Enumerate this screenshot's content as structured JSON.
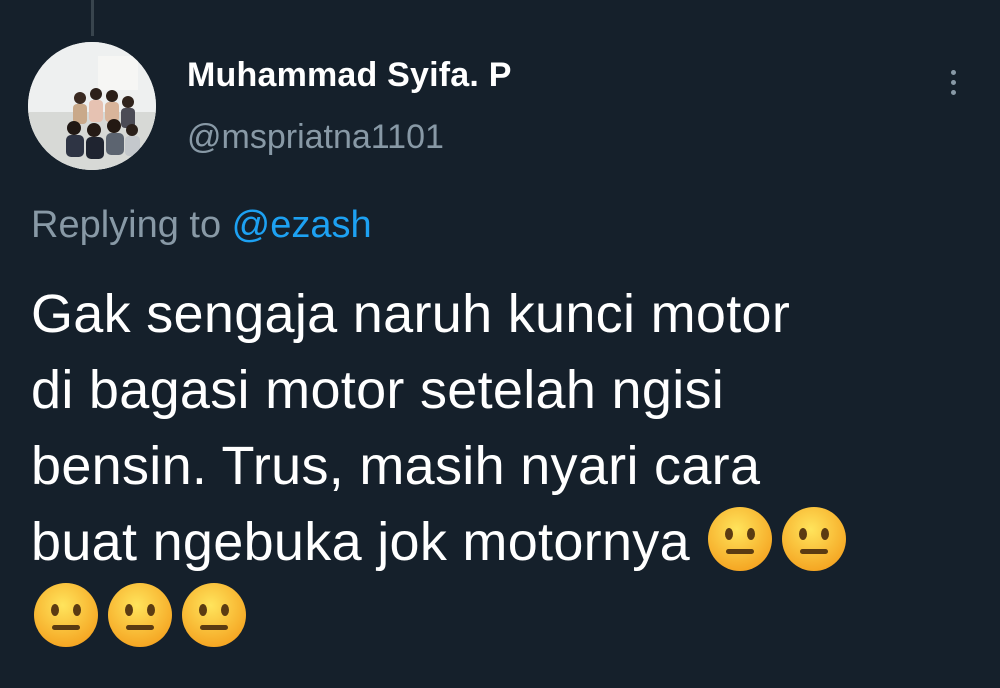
{
  "author": {
    "display_name": "Muhammad Syifa. P",
    "handle": "@mspriatna1101",
    "avatar_icon": "group-photo-avatar"
  },
  "reply": {
    "prefix": "Replying to ",
    "mention": "@ezash"
  },
  "tweet": {
    "lines": [
      "Gak sengaja naruh kunci motor",
      "di bagasi motor setelah ngisi",
      "bensin. Trus, masih nyari cara",
      "buat ngebuka jok motornya "
    ],
    "emoji_name": "neutral-face"
  },
  "icons": {
    "more": "more-vertical-icon"
  },
  "colors": {
    "background": "#15202b",
    "text_primary": "#ffffff",
    "text_secondary": "#8899a6",
    "accent": "#1da1f2"
  }
}
